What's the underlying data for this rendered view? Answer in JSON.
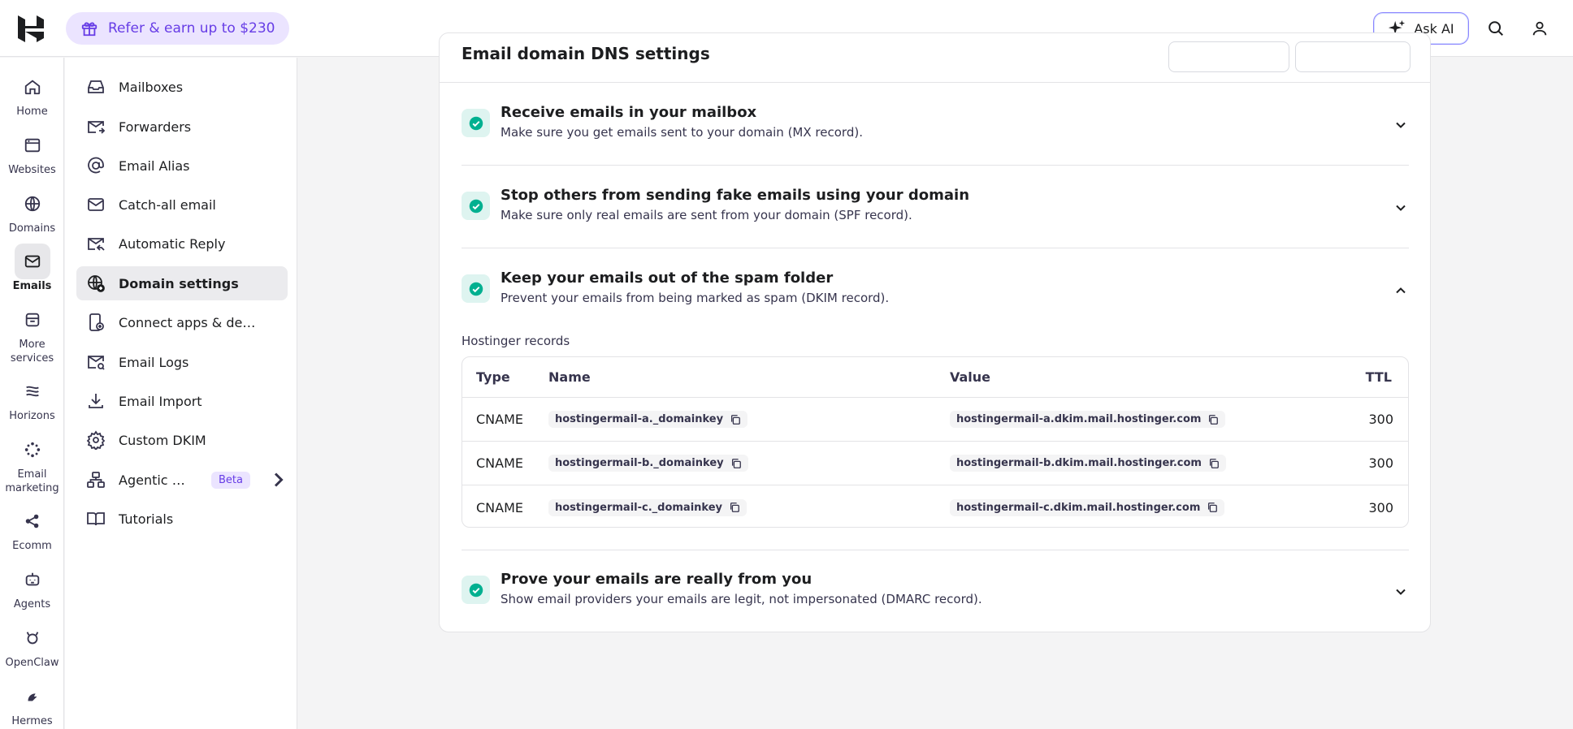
{
  "header": {
    "refer_label": "Refer & earn up to $230",
    "ask_ai_label": "Ask AI"
  },
  "rail": [
    {
      "label": "Home",
      "icon": "home-icon"
    },
    {
      "label": "Websites",
      "icon": "websites-icon"
    },
    {
      "label": "Domains",
      "icon": "globe-icon"
    },
    {
      "label": "Emails",
      "icon": "mail-icon",
      "active": true
    },
    {
      "label": "More services",
      "icon": "store-icon"
    },
    {
      "label": "Horizons",
      "icon": "horizons-icon"
    },
    {
      "label": "Email marketing",
      "icon": "sparkle-icon"
    },
    {
      "label": "Ecomm",
      "icon": "ecomm-icon"
    },
    {
      "label": "Agents",
      "icon": "agents-icon"
    },
    {
      "label": "OpenClaw",
      "icon": "openclaw-icon"
    },
    {
      "label": "Hermes",
      "icon": "hermes-icon"
    }
  ],
  "subnav": [
    {
      "label": "Mailboxes",
      "icon": "inbox-icon"
    },
    {
      "label": "Forwarders",
      "icon": "forward-mail-icon"
    },
    {
      "label": "Email Alias",
      "icon": "at-icon"
    },
    {
      "label": "Catch-all email",
      "icon": "mail-icon"
    },
    {
      "label": "Automatic Reply",
      "icon": "auto-reply-icon"
    },
    {
      "label": "Domain settings",
      "icon": "globe-settings-icon",
      "active": true
    },
    {
      "label": "Connect apps & devic...",
      "icon": "device-icon"
    },
    {
      "label": "Email Logs",
      "icon": "mail-search-icon"
    },
    {
      "label": "Email Import",
      "icon": "download-icon"
    },
    {
      "label": "Custom DKIM",
      "icon": "gear-icon"
    },
    {
      "label": "Agentic mail",
      "icon": "agentic-icon",
      "badge": "Beta"
    },
    {
      "label": "Tutorials",
      "icon": "book-icon"
    }
  ],
  "card": {
    "title": "Email domain DNS settings",
    "sections": [
      {
        "title": "Receive emails in your mailbox",
        "desc": "Make sure you get emails sent to your domain (MX record).",
        "expanded": false
      },
      {
        "title": "Stop others from sending fake emails using your domain",
        "desc": "Make sure only real emails are sent from your domain (SPF record).",
        "expanded": false
      },
      {
        "title": "Keep your emails out of the spam folder",
        "desc": "Prevent your emails from being marked as spam (DKIM record).",
        "expanded": true
      },
      {
        "title": "Prove your emails are really from you",
        "desc": "Show email providers your emails are legit, not impersonated (DMARC record).",
        "expanded": false
      }
    ],
    "records_label": "Hostinger records",
    "table": {
      "headers": {
        "type": "Type",
        "name": "Name",
        "value": "Value",
        "ttl": "TTL"
      },
      "rows": [
        {
          "type": "CNAME",
          "name": "hostingermail-a._domainkey",
          "value": "hostingermail-a.dkim.mail.hostinger.com",
          "ttl": "300"
        },
        {
          "type": "CNAME",
          "name": "hostingermail-b._domainkey",
          "value": "hostingermail-b.dkim.mail.hostinger.com",
          "ttl": "300"
        },
        {
          "type": "CNAME",
          "name": "hostingermail-c._domainkey",
          "value": "hostingermail-c.dkim.mail.hostinger.com",
          "ttl": "300"
        }
      ]
    }
  },
  "colors": {
    "accent": "#673de6",
    "success": "#00b090"
  }
}
